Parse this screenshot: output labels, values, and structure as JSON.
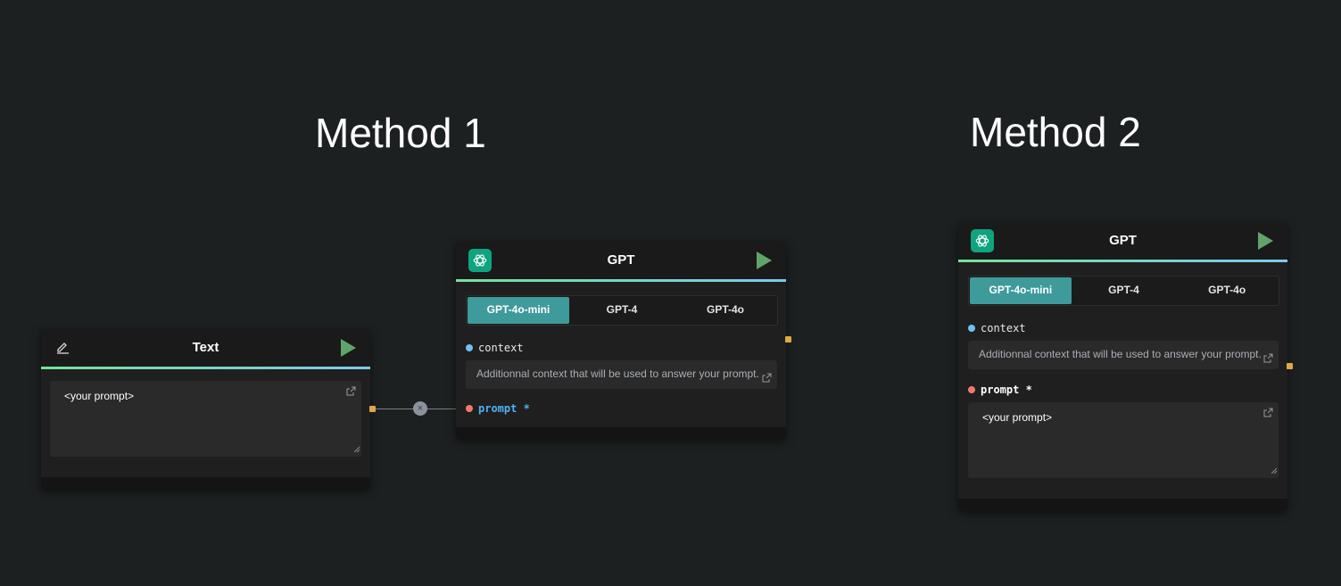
{
  "methods": {
    "method1_title": "Method 1",
    "method2_title": "Method 2"
  },
  "text_node": {
    "title": "Text",
    "icon": "pencil-icon",
    "prompt_value": "<your prompt>"
  },
  "gpt_node_1": {
    "title": "GPT",
    "icon": "openai-logo-icon",
    "tabs": [
      {
        "label": "GPT-4o-mini",
        "active": true
      },
      {
        "label": "GPT-4",
        "active": false
      },
      {
        "label": "GPT-4o",
        "active": false
      }
    ],
    "context_label": "context",
    "context_placeholder": "Additionnal context that will be used to answer your prompt.",
    "prompt_label": "prompt",
    "required_marker": "*"
  },
  "gpt_node_2": {
    "title": "GPT",
    "icon": "openai-logo-icon",
    "tabs": [
      {
        "label": "GPT-4o-mini",
        "active": true
      },
      {
        "label": "GPT-4",
        "active": false
      },
      {
        "label": "GPT-4o",
        "active": false
      }
    ],
    "context_label": "context",
    "context_placeholder": "Additionnal context that will be used to answer your prompt.",
    "prompt_label": "prompt",
    "required_marker": "*",
    "prompt_value": "<your prompt>"
  },
  "edge": {
    "remove_symbol": "×"
  },
  "colors": {
    "background": "#1d2021",
    "accent_teal": "#3f9a9b",
    "run_green": "#5fa56a",
    "handle_orange": "#e0a840",
    "context_dot": "#6ec1f5",
    "prompt_dot": "#f07a6a",
    "linked_prompt_label": "#4fb3f5"
  }
}
